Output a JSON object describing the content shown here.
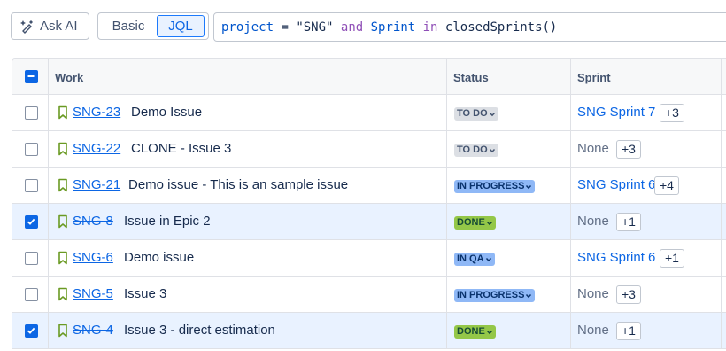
{
  "toolbar": {
    "ask_ai_label": "Ask AI",
    "basic_label": "Basic",
    "jql_label": "JQL",
    "query": {
      "field1": "project",
      "op1": " = ",
      "value1": "\"SNG\"",
      "and": " and ",
      "field2": "Sprint",
      "in": " in ",
      "fn": "closedSprints()"
    }
  },
  "table": {
    "columns": {
      "work": "Work",
      "status": "Status",
      "sprint": "Sprint"
    },
    "rows": [
      {
        "key": "SNG-23",
        "summary": "Demo Issue",
        "status": "TO DO",
        "status_style": "todo",
        "sprint": "SNG Sprint 7",
        "sprint_link": true,
        "more": "+3",
        "checked": false,
        "done": false
      },
      {
        "key": "SNG-22",
        "summary": "CLONE - Issue 3",
        "status": "TO DO",
        "status_style": "todo",
        "sprint": "None",
        "sprint_link": false,
        "more": "+3",
        "checked": false,
        "done": false
      },
      {
        "key": "SNG-21",
        "summary": "Demo issue - This is an sample issue",
        "status": "IN PROGRESS",
        "status_style": "prog",
        "sprint": "SNG Sprint 6",
        "sprint_link": true,
        "more": "+4",
        "checked": false,
        "done": false
      },
      {
        "key": "SNG-8",
        "summary": "Issue in Epic 2",
        "status": "DONE",
        "status_style": "done",
        "sprint": "None",
        "sprint_link": false,
        "more": "+1",
        "checked": true,
        "done": true
      },
      {
        "key": "SNG-6",
        "summary": "Demo issue",
        "status": "IN QA",
        "status_style": "prog",
        "sprint": "SNG Sprint 6",
        "sprint_link": true,
        "more": "+1",
        "checked": false,
        "done": false
      },
      {
        "key": "SNG-5",
        "summary": "Issue 3",
        "status": "IN PROGRESS",
        "status_style": "prog",
        "sprint": "None",
        "sprint_link": false,
        "more": "+3",
        "checked": false,
        "done": false
      },
      {
        "key": "SNG-4",
        "summary": "Issue 3 - direct estimation",
        "status": "DONE",
        "status_style": "done",
        "sprint": "None",
        "sprint_link": false,
        "more": "+1",
        "checked": true,
        "done": true
      }
    ]
  },
  "colors": {
    "link": "#0c66e4",
    "selected_row": "#e9f2ff",
    "done_lozenge": "#94c748",
    "progress_lozenge": "#8fb8f6",
    "todo_lozenge": "#dcdfe4",
    "bookmark_icon": "#6a9a23"
  },
  "icons": {
    "ask_ai": "sparkle-pen-icon",
    "issue_type": "bookmark-icon",
    "status_dropdown": "chevron-down-icon",
    "checkbox_checked": "check-icon",
    "header_checkbox": "minus-icon"
  }
}
